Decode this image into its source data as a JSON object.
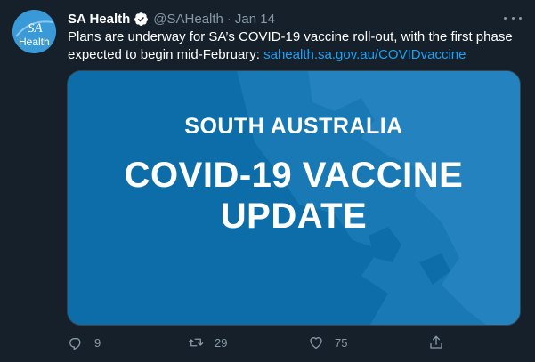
{
  "tweet": {
    "avatar_text_line1": "SA",
    "avatar_text_line2": "Health",
    "name": "SA Health",
    "handle": "@SAHealth",
    "separator": "·",
    "date": "Jan 14",
    "text_before_link": "Plans are underway for SA’s COVID-19 vaccine roll-out, with the first phase expected to begin mid-February: ",
    "link_text": "sahealth.sa.gov.au/COVIDvaccine",
    "card": {
      "line1": "SOUTH AUSTRALIA",
      "line2": "COVID-19 VACCINE",
      "line3": "UPDATE"
    },
    "actions": {
      "replies": "9",
      "retweets": "29",
      "likes": "75"
    }
  },
  "colors": {
    "background": "#15202b",
    "secondary_text": "#8899a6",
    "link": "#1da1f2",
    "card_blue": "#0d6da8",
    "verified_badge": "#ffffff"
  },
  "icons": {
    "avatar": "sa-health-logo",
    "verified": "verified-badge-icon",
    "more": "more-options-icon",
    "reply": "reply-icon",
    "retweet": "retweet-icon",
    "like": "heart-icon",
    "share": "share-icon"
  }
}
